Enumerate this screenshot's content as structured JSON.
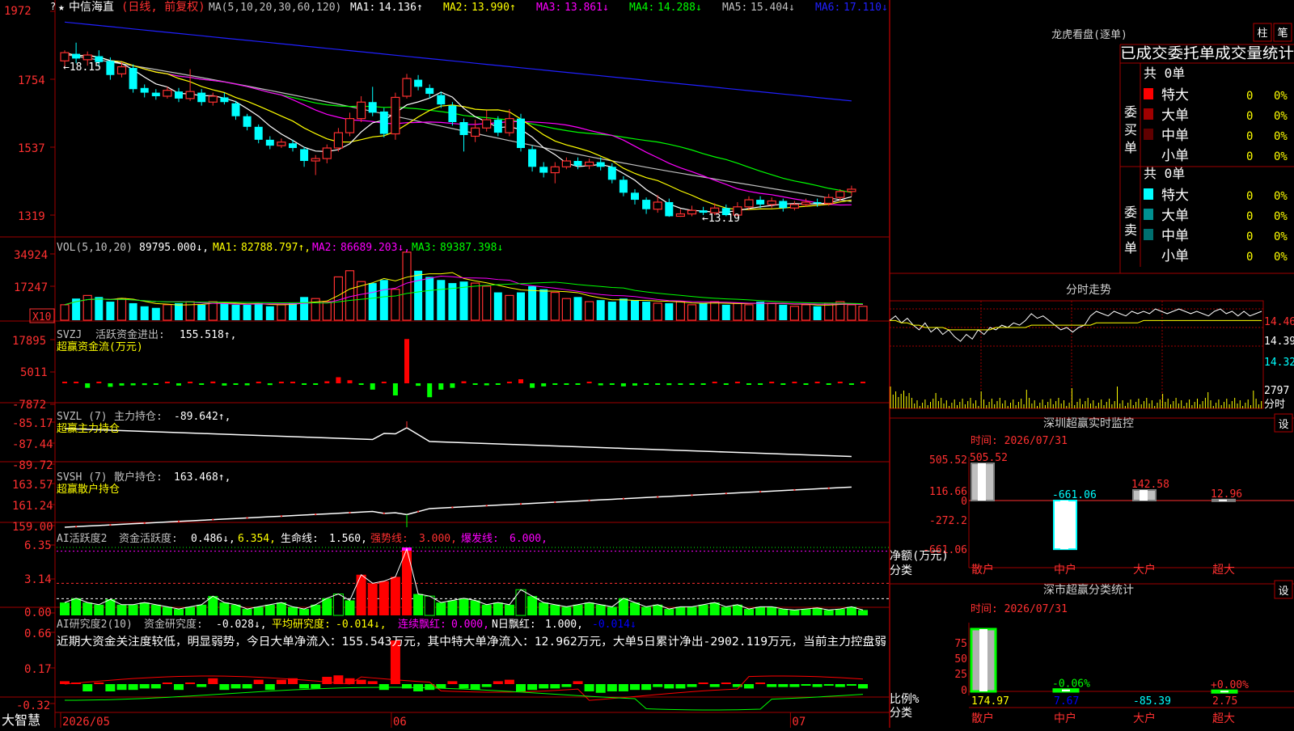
{
  "colors": {
    "up": "#ff3030",
    "down": "#00ffff",
    "grid": "#a00000",
    "ma1": "#ffffff",
    "ma2": "#ffff00",
    "ma3": "#ff00ff",
    "ma4": "#00ff00",
    "ma5": "#c0c0c0",
    "ma6": "#2020ff",
    "bg": "#000000"
  },
  "main": {
    "header_star": "★",
    "stock_name": "中信海直",
    "period": "(日线, 前复权)",
    "ma_title": "MA(5,10,20,30,60,120)",
    "ma_items": [
      {
        "label": "MA1:",
        "value": "14.136↑",
        "color": "#ffffff"
      },
      {
        "label": "MA2:",
        "value": "13.990↑",
        "color": "#ffff00"
      },
      {
        "label": "MA3:",
        "value": "13.861↓",
        "color": "#ff00ff"
      },
      {
        "label": "MA4:",
        "value": "14.288↓",
        "color": "#00ff00"
      },
      {
        "label": "MA5:",
        "value": "15.404↓",
        "color": "#c0c0c0"
      },
      {
        "label": "MA6:",
        "value": "17.110↓",
        "color": "#2020ff"
      }
    ],
    "y_labels": [
      "1972",
      "1754",
      "1537",
      "1319"
    ],
    "high_label": "←18.15",
    "low_label": "←13.19",
    "question_mark": "?"
  },
  "candles": [
    {
      "o": 17.84,
      "c": 17.98,
      "h": 18.02,
      "l": 17.7
    },
    {
      "o": 17.96,
      "c": 17.88,
      "h": 18.15,
      "l": 17.8
    },
    {
      "o": 17.86,
      "c": 17.94,
      "h": 18.0,
      "l": 17.76
    },
    {
      "o": 17.92,
      "c": 17.82,
      "h": 18.02,
      "l": 17.74
    },
    {
      "o": 17.84,
      "c": 17.6,
      "h": 17.9,
      "l": 17.52
    },
    {
      "o": 17.62,
      "c": 17.74,
      "h": 17.82,
      "l": 17.56
    },
    {
      "o": 17.72,
      "c": 17.36,
      "h": 17.78,
      "l": 17.3
    },
    {
      "o": 17.38,
      "c": 17.3,
      "h": 17.44,
      "l": 17.22
    },
    {
      "o": 17.3,
      "c": 17.24,
      "h": 17.36,
      "l": 17.18
    },
    {
      "o": 17.24,
      "c": 17.34,
      "h": 17.4,
      "l": 17.2
    },
    {
      "o": 17.32,
      "c": 17.2,
      "h": 17.38,
      "l": 17.14
    },
    {
      "o": 17.2,
      "c": 17.32,
      "h": 17.7,
      "l": 17.16
    },
    {
      "o": 17.3,
      "c": 17.14,
      "h": 17.36,
      "l": 17.08
    },
    {
      "o": 17.14,
      "c": 17.24,
      "h": 17.3,
      "l": 17.08
    },
    {
      "o": 17.22,
      "c": 17.14,
      "h": 17.3,
      "l": 17.1
    },
    {
      "o": 17.12,
      "c": 16.9,
      "h": 17.16,
      "l": 16.84
    },
    {
      "o": 16.9,
      "c": 16.72,
      "h": 16.94,
      "l": 16.66
    },
    {
      "o": 16.72,
      "c": 16.5,
      "h": 16.76,
      "l": 16.44
    },
    {
      "o": 16.5,
      "c": 16.4,
      "h": 16.56,
      "l": 16.34
    },
    {
      "o": 16.4,
      "c": 16.46,
      "h": 16.52,
      "l": 16.36
    },
    {
      "o": 16.44,
      "c": 16.36,
      "h": 16.5,
      "l": 16.3
    },
    {
      "o": 16.34,
      "c": 16.14,
      "h": 16.38,
      "l": 16.04
    },
    {
      "o": 16.14,
      "c": 16.18,
      "h": 16.24,
      "l": 15.9
    },
    {
      "o": 16.18,
      "c": 16.36,
      "h": 16.42,
      "l": 16.1
    },
    {
      "o": 16.36,
      "c": 16.62,
      "h": 16.7,
      "l": 16.3
    },
    {
      "o": 16.62,
      "c": 16.86,
      "h": 16.96,
      "l": 16.56
    },
    {
      "o": 16.86,
      "c": 17.14,
      "h": 17.24,
      "l": 16.8
    },
    {
      "o": 17.14,
      "c": 16.96,
      "h": 17.4,
      "l": 16.9
    },
    {
      "o": 16.98,
      "c": 16.6,
      "h": 17.04,
      "l": 16.54
    },
    {
      "o": 16.6,
      "c": 17.22,
      "h": 17.3,
      "l": 16.5
    },
    {
      "o": 17.24,
      "c": 17.54,
      "h": 17.62,
      "l": 17.2
    },
    {
      "o": 17.52,
      "c": 17.4,
      "h": 17.6,
      "l": 17.34
    },
    {
      "o": 17.38,
      "c": 17.28,
      "h": 17.44,
      "l": 17.2
    },
    {
      "o": 17.26,
      "c": 17.1,
      "h": 17.32,
      "l": 17.04
    },
    {
      "o": 17.08,
      "c": 16.8,
      "h": 17.14,
      "l": 16.74
    },
    {
      "o": 16.8,
      "c": 16.58,
      "h": 16.86,
      "l": 16.3
    },
    {
      "o": 16.56,
      "c": 16.7,
      "h": 16.84,
      "l": 16.46
    },
    {
      "o": 16.7,
      "c": 16.84,
      "h": 17.0,
      "l": 16.64
    },
    {
      "o": 16.84,
      "c": 16.62,
      "h": 16.9,
      "l": 16.56
    },
    {
      "o": 16.62,
      "c": 16.86,
      "h": 17.02,
      "l": 16.56
    },
    {
      "o": 16.86,
      "c": 16.36,
      "h": 16.94,
      "l": 16.3
    },
    {
      "o": 16.34,
      "c": 16.04,
      "h": 16.4,
      "l": 15.96
    },
    {
      "o": 16.04,
      "c": 15.94,
      "h": 16.12,
      "l": 15.86
    },
    {
      "o": 15.94,
      "c": 16.04,
      "h": 16.12,
      "l": 15.76
    },
    {
      "o": 16.04,
      "c": 16.14,
      "h": 16.2,
      "l": 16.0
    },
    {
      "o": 16.14,
      "c": 16.06,
      "h": 16.2,
      "l": 16.0
    },
    {
      "o": 16.06,
      "c": 16.12,
      "h": 16.18,
      "l": 16.0
    },
    {
      "o": 16.12,
      "c": 16.04,
      "h": 16.2,
      "l": 15.98
    },
    {
      "o": 16.04,
      "c": 15.82,
      "h": 16.1,
      "l": 15.76
    },
    {
      "o": 15.82,
      "c": 15.6,
      "h": 15.88,
      "l": 15.54
    },
    {
      "o": 15.6,
      "c": 15.48,
      "h": 15.66,
      "l": 15.4
    },
    {
      "o": 15.48,
      "c": 15.32,
      "h": 15.52,
      "l": 15.24
    },
    {
      "o": 15.32,
      "c": 15.44,
      "h": 15.56,
      "l": 15.26
    },
    {
      "o": 15.44,
      "c": 15.2,
      "h": 15.5,
      "l": 15.19
    },
    {
      "o": 15.2,
      "c": 15.24,
      "h": 15.32,
      "l": 15.19
    },
    {
      "o": 15.24,
      "c": 15.3,
      "h": 15.38,
      "l": 15.2
    },
    {
      "o": 15.3,
      "c": 15.26,
      "h": 15.36,
      "l": 15.22
    },
    {
      "o": 15.26,
      "c": 15.34,
      "h": 15.42,
      "l": 15.22
    },
    {
      "o": 15.34,
      "c": 15.22,
      "h": 15.4,
      "l": 15.2
    },
    {
      "o": 15.22,
      "c": 15.36,
      "h": 15.44,
      "l": 15.2
    },
    {
      "o": 15.36,
      "c": 15.48,
      "h": 15.54,
      "l": 15.3
    },
    {
      "o": 15.48,
      "c": 15.4,
      "h": 15.54,
      "l": 15.34
    },
    {
      "o": 15.4,
      "c": 15.46,
      "h": 15.52,
      "l": 15.34
    },
    {
      "o": 15.46,
      "c": 15.34,
      "h": 15.5,
      "l": 15.28
    },
    {
      "o": 15.34,
      "c": 15.4,
      "h": 15.46,
      "l": 15.3
    },
    {
      "o": 15.4,
      "c": 15.44,
      "h": 15.5,
      "l": 15.36
    },
    {
      "o": 15.44,
      "c": 15.42,
      "h": 15.5,
      "l": 15.36
    },
    {
      "o": 15.42,
      "c": 15.52,
      "h": 15.58,
      "l": 15.38
    },
    {
      "o": 15.52,
      "c": 15.62,
      "h": 15.66,
      "l": 15.46
    },
    {
      "o": 15.62,
      "c": 15.66,
      "h": 15.72,
      "l": 15.54
    }
  ],
  "vol": {
    "title": "VOL(5,10,20)",
    "value": "89795.000↓,",
    "items": [
      {
        "label": "MA1:",
        "value": "82788.797↑,",
        "color": "#ffff00"
      },
      {
        "label": "MA2:",
        "value": "86689.203↓,",
        "color": "#ff00ff"
      },
      {
        "label": "MA3:",
        "value": "89387.398↓",
        "color": "#00ff00"
      }
    ],
    "y_labels": [
      "34924",
      "17247"
    ],
    "unit": "X10",
    "bars": [
      10,
      14,
      16,
      15,
      12,
      14,
      11,
      9,
      8,
      10,
      11,
      12,
      10,
      12,
      11,
      10,
      10,
      11,
      9,
      10,
      11,
      15,
      14,
      12,
      28,
      32,
      25,
      24,
      26,
      20,
      44,
      32,
      28,
      26,
      24,
      25,
      24,
      22,
      18,
      16,
      18,
      22,
      20,
      18,
      14,
      15,
      12,
      13,
      12,
      14,
      13,
      12,
      11,
      11,
      12,
      10,
      11,
      12,
      10,
      11,
      10,
      12,
      11,
      10,
      9,
      10,
      9,
      11,
      12,
      10,
      9
    ]
  },
  "svzj": {
    "title": "SVZJ",
    "label": "活跃资金进出:",
    "value": "155.518↑,",
    "subtitle": "超赢资金流(万元)",
    "y_labels": [
      "17895",
      "5011",
      "-7872"
    ],
    "bars": [
      200,
      300,
      -1800,
      300,
      -1400,
      -900,
      -800,
      -700,
      -600,
      300,
      -900,
      500,
      -500,
      700,
      -900,
      -500,
      -800,
      500,
      -700,
      400,
      500,
      -600,
      -500,
      800,
      2400,
      1200,
      -400,
      -2500,
      300,
      -4800,
      17500,
      -1000,
      -5500,
      -2500,
      -1800,
      800,
      -600,
      -800,
      -300,
      400,
      1600,
      -1800,
      -1200,
      -600,
      -400,
      -500,
      600,
      -800,
      -600,
      -1200,
      -900,
      -400,
      -300,
      -700,
      -500,
      -500,
      -300,
      200,
      -500,
      400,
      -600,
      -400,
      300,
      -500,
      200,
      -300,
      400,
      -200,
      300,
      -200,
      155
    ]
  },
  "svzl": {
    "title": "SVZL (7)",
    "label": "主力持仓:",
    "value": "-89.642↑,",
    "subtitle": "超赢主力持仓",
    "y_labels": [
      "-85.17",
      "-87.44",
      "-89.72"
    ]
  },
  "svsh": {
    "title": "SVSH (7)",
    "label": "散户持仓:",
    "value": "163.468↑,",
    "subtitle": "超赢散户持仓",
    "y_labels": [
      "163.57",
      "161.24",
      "159.00"
    ]
  },
  "ai1": {
    "title": "AI活跃度2",
    "label": "资金活跃度:",
    "value": "0.486↓,",
    "value2": "6.354,",
    "life_label": "生命线:",
    "life_value": "1.560,",
    "strong_label": "强势线:",
    "strong_value": "3.000,",
    "burst_label": "爆发线:",
    "burst_value": "6.000,",
    "y_labels": [
      "6.35",
      "3.14",
      "0.00"
    ],
    "bars": [
      1.2,
      1.6,
      1.2,
      1.0,
      1.5,
      1.0,
      1.0,
      1.2,
      1.0,
      0.8,
      0.6,
      0.8,
      1.0,
      1.8,
      1.2,
      1.0,
      0.6,
      0.8,
      1.0,
      1.2,
      0.8,
      0.6,
      1.0,
      1.6,
      2.0,
      1.4,
      3.8,
      3.0,
      3.2,
      3.6,
      6.2,
      2.0,
      1.8,
      1.2,
      1.4,
      1.6,
      1.4,
      1.0,
      1.2,
      1.0,
      2.4,
      1.8,
      1.2,
      1.0,
      0.8,
      1.0,
      1.2,
      1.0,
      0.8,
      1.6,
      1.2,
      0.8,
      1.0,
      0.6,
      0.8,
      0.8,
      1.0,
      1.2,
      0.8,
      1.0,
      0.6,
      0.8,
      0.8,
      0.6,
      0.5,
      0.6,
      0.7,
      0.5,
      0.6,
      0.8,
      0.5
    ]
  },
  "ai2": {
    "title": "AI研究度2(10)",
    "label": "资金研究度:",
    "value": "-0.028↓,",
    "avg_label": "平均研究度:",
    "avg_value": "-0.014↓,",
    "cont_label": "连续飘红:",
    "cont_value": "0.000,",
    "n_label": "N日飘红:",
    "n_value": "1.000,",
    "last_value": "-0.014↓",
    "comment": "近期大资金关注度较低，明显弱势，今日大单净流入：155.543万元，其中特大单净流入：12.962万元，大单5日累计净出-2902.119万元，当前主力控盘弱",
    "y_labels": [
      "0.66",
      "0.17",
      "-0.32"
    ],
    "bars": [
      0.02,
      0.01,
      -0.05,
      0.01,
      -0.05,
      -0.04,
      -0.04,
      -0.03,
      -0.03,
      0.01,
      -0.04,
      0.01,
      -0.02,
      0.04,
      -0.04,
      -0.03,
      -0.03,
      0.03,
      -0.04,
      0.03,
      0.04,
      -0.03,
      -0.03,
      0.05,
      0.06,
      0.04,
      0.03,
      0.02,
      -0.04,
      0.3,
      -0.03,
      -0.05,
      -0.04,
      -0.03,
      0.02,
      -0.03,
      -0.04,
      -0.02,
      0.02,
      0.03,
      -0.05,
      -0.04,
      -0.03,
      -0.03,
      -0.02,
      0.02,
      -0.05,
      -0.06,
      -0.05,
      -0.05,
      -0.04,
      -0.04,
      -0.02,
      -0.03,
      -0.03,
      -0.02,
      0.01,
      -0.02,
      0.01,
      -0.02,
      -0.03,
      0.01,
      -0.02,
      -0.02,
      -0.02,
      -0.01,
      -0.02,
      -0.01,
      -0.02,
      -0.01,
      -0.03
    ]
  },
  "xaxis": {
    "labels": [
      "2026/05",
      "06",
      "07"
    ],
    "positions": [
      0,
      29,
      64
    ]
  },
  "brand": "大智慧",
  "right": {
    "lhb_title": "龙虎看盘(逐单)",
    "btn_zhu": "柱",
    "btn_bi": "笔",
    "tabs": "已成交委托单成交量统计",
    "buy": {
      "header": "共 0单",
      "side_label": "委买单",
      "rows": [
        {
          "name": "特大",
          "count": "0",
          "pct": "0%",
          "color": "#ff0000"
        },
        {
          "name": "大单",
          "count": "0",
          "pct": "0%",
          "color": "#a00000"
        },
        {
          "name": "中单",
          "count": "0",
          "pct": "0%",
          "color": "#600000"
        },
        {
          "name": "小单",
          "count": "0",
          "pct": "0%",
          "color": "#000000"
        }
      ]
    },
    "sell": {
      "header": "共 0单",
      "side_label": "委卖单",
      "rows": [
        {
          "name": "特大",
          "count": "0",
          "pct": "0%",
          "color": "#00ffff"
        },
        {
          "name": "大单",
          "count": "0",
          "pct": "0%",
          "color": "#009090"
        },
        {
          "name": "中单",
          "count": "0",
          "pct": "0%",
          "color": "#007070"
        },
        {
          "name": "小单",
          "count": "0",
          "pct": "0%",
          "color": "#000000"
        }
      ]
    },
    "fs_title": "分时走势",
    "fs_labels": [
      "14.46",
      "14.39",
      "14.32",
      "2797",
      "分时"
    ],
    "fs_line": [
      14.42,
      14.44,
      14.41,
      14.43,
      14.4,
      14.38,
      14.41,
      14.37,
      14.39,
      14.36,
      14.38,
      14.35,
      14.33,
      14.36,
      14.34,
      14.38,
      14.36,
      14.39,
      14.38,
      14.4,
      14.39,
      14.41,
      14.4,
      14.42,
      14.45,
      14.43,
      14.44,
      14.42,
      14.4,
      14.38,
      14.39,
      14.37,
      14.39,
      14.4,
      14.44,
      14.46,
      14.45,
      14.44,
      14.46,
      14.45,
      14.44,
      14.46,
      14.45,
      14.46,
      14.45,
      14.47,
      14.46,
      14.45,
      14.46,
      14.47,
      14.46,
      14.45,
      14.46,
      14.45,
      14.44,
      14.46,
      14.47,
      14.45,
      14.46,
      14.44,
      14.46,
      14.44,
      14.45,
      14.46
    ],
    "fs_avg": [
      14.42,
      14.42,
      14.41,
      14.41,
      14.4,
      14.4,
      14.39,
      14.39,
      14.39,
      14.39,
      14.38,
      14.38,
      14.38,
      14.38,
      14.38,
      14.38,
      14.38,
      14.38,
      14.39,
      14.39,
      14.39,
      14.39,
      14.39,
      14.39,
      14.4,
      14.4,
      14.4,
      14.4,
      14.4,
      14.4,
      14.4,
      14.4,
      14.4,
      14.4,
      14.4,
      14.41,
      14.41,
      14.41,
      14.41,
      14.41,
      14.41,
      14.41,
      14.41,
      14.42,
      14.42,
      14.42,
      14.42,
      14.42,
      14.42,
      14.42,
      14.42,
      14.42,
      14.42,
      14.42,
      14.42,
      14.42,
      14.42,
      14.42,
      14.42,
      14.42,
      14.42,
      14.42,
      14.42,
      14.42
    ],
    "sz_title": "深圳超赢实时监控",
    "sz_btn": "设",
    "sz_time": "时间: 2026/07/31",
    "sz_y_labels": [
      "505.52",
      "116.66",
      "0",
      "-272.2",
      "-661.06"
    ],
    "sz_axis_name": "净额(万元)",
    "sz_axis_cat": "分类",
    "sz_bars": [
      {
        "name": "散户",
        "value": 505.52,
        "label": "505.52",
        "label_color": "#ff3030",
        "fill": "#c0c0c0"
      },
      {
        "name": "中户",
        "value": -661.06,
        "label": "-661.06",
        "label_color": "#00ffff",
        "fill": "#ffffff"
      },
      {
        "name": "大户",
        "value": 142.58,
        "label": "142.58",
        "label_color": "#ff3030",
        "fill": "#c0c0c0"
      },
      {
        "name": "超大",
        "value": 12.96,
        "label": "12.96",
        "label_color": "#ff3030",
        "fill": "#c0c0c0"
      }
    ],
    "sc_title": "深市超赢分类统计",
    "sc_btn": "设",
    "sc_time": "时间: 2026/07/31",
    "sc_y_labels": [
      "75",
      "50",
      "25",
      "0"
    ],
    "sc_axis_name": "比例%",
    "sc_axis_cat": "分类",
    "sc_bars": [
      {
        "name": "散户",
        "value": 100,
        "value_label": "174.97",
        "value_color": "#ffff00"
      },
      {
        "name": "中户",
        "value": 3,
        "top_label": "-0.06%",
        "top_color": "#00ff00",
        "value_label": "7.67",
        "value_color": "#0000ff"
      },
      {
        "name": "大户",
        "value": 0,
        "value_label": "-85.39",
        "value_color": "#00ffff"
      },
      {
        "name": "超大",
        "value": 1,
        "top_label": "+0.00%",
        "top_color": "#ff3030",
        "value_label": "2.75",
        "value_color": "#ff3030"
      }
    ]
  }
}
